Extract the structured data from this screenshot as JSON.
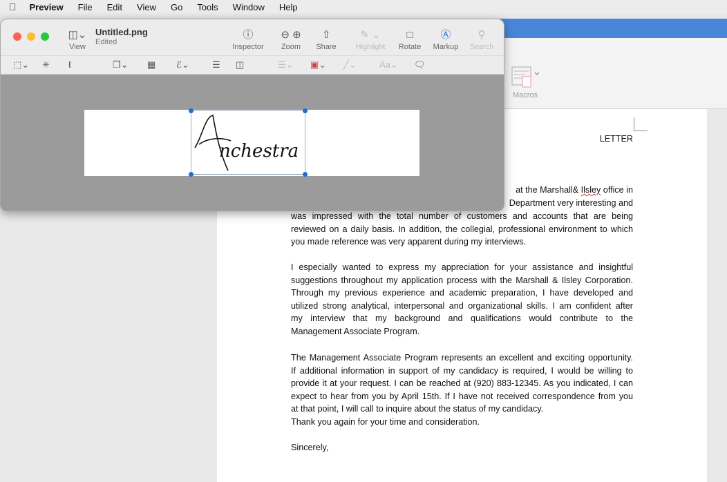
{
  "menubar": {
    "apple": "",
    "app": "Preview",
    "items": [
      "File",
      "Edit",
      "View",
      "Go",
      "Tools",
      "Window",
      "Help"
    ]
  },
  "word": {
    "ribbon": {
      "macros_label": "Macros"
    },
    "document": {
      "heading_partial": "LETTER",
      "para1_partial": [
        "at the Marshall& Ilsley office in",
        "Department very interesting and"
      ],
      "para1_lines": [
        "was impressed with the total number of customers and accounts that are being",
        "reviewed on a daily basis. In addition, the collegial, professional environment to which",
        "you made reference was very apparent during my interviews."
      ],
      "para2_lines": [
        "I especially wanted to express my appreciation for your assistance and insightful",
        "suggestions throughout my application process with the Marshall & Ilsley Corporation.",
        "Through my previous experience and academic preparation, I have developed and",
        "utilized strong analytical, interpersonal and organizational skills. I am confident after",
        "my interview that my background and qualifications would contribute to the",
        "Management Associate Program."
      ],
      "para3_lines": [
        "The Management Associate Program represents an excellent and exciting opportunity.",
        "If additional information in support of my candidacy is required, I would be willing to",
        "provide it at your request. I can be reached at (920) 883-12345. As you indicated, I can",
        "expect to hear from you by April 15th. If I have not received correspondence from you",
        "at that point, I will call to inquire about the status of my candidacy.",
        "Thank you again for your time and consideration."
      ],
      "closing": "Sincerely,"
    }
  },
  "preview": {
    "title": "Untitled.png",
    "subtitle": "Edited",
    "toolbar": {
      "view": "View",
      "inspector": "Inspector",
      "zoom": "Zoom",
      "share": "Share",
      "highlight": "Highlight",
      "rotate": "Rotate",
      "markup": "Markup",
      "search": "Search"
    },
    "signature_text": "Anchestra",
    "accent": "#1f6fd1"
  }
}
